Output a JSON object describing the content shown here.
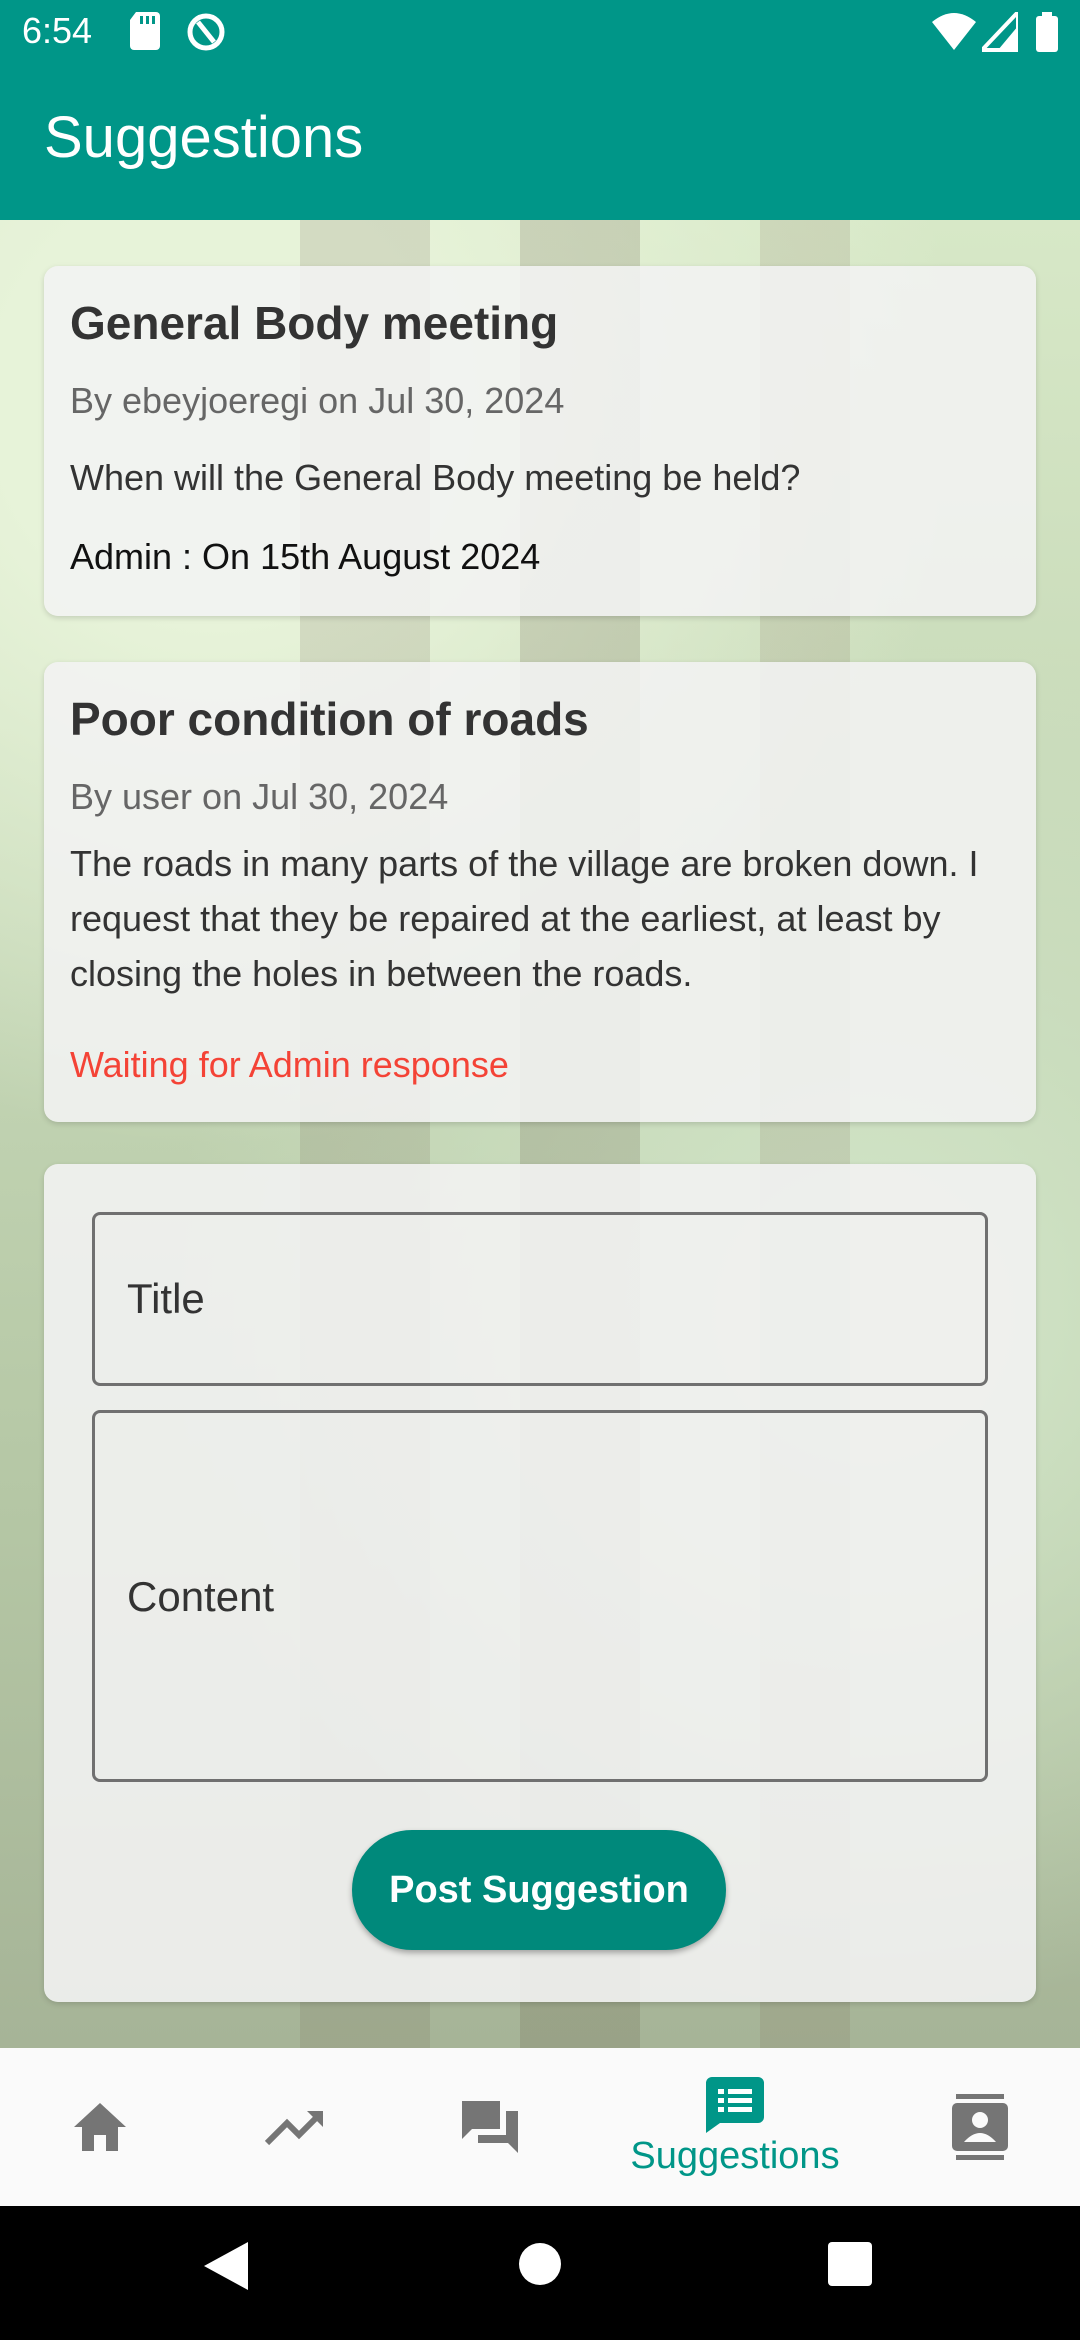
{
  "status_bar": {
    "time": "6:54"
  },
  "app_bar": {
    "title": "Suggestions"
  },
  "suggestions": [
    {
      "title": "General Body meeting",
      "meta": "By ebeyjoeregi on Jul 30, 2024",
      "body": "When will the General Body meeting be held?",
      "reply": "Admin : On 15th August 2024"
    },
    {
      "title": "Poor condition of roads",
      "meta": "By user on Jul 30, 2024",
      "body": "The roads in many parts of the village are broken down. I request that they be repaired at the earliest, at least by closing the holes in between the roads.",
      "status": "Waiting for Admin response"
    }
  ],
  "form": {
    "title_label": "Title",
    "content_label": "Content",
    "post_button": "Post Suggestion"
  },
  "bottom_nav": {
    "items": [
      {
        "icon": "home-icon"
      },
      {
        "icon": "trending-icon"
      },
      {
        "icon": "forum-icon"
      },
      {
        "icon": "suggestions-icon",
        "label": "Suggestions",
        "active": true
      },
      {
        "icon": "contacts-icon"
      }
    ]
  },
  "colors": {
    "primary": "#009688",
    "button": "#00897b",
    "waiting": "#f44336"
  }
}
